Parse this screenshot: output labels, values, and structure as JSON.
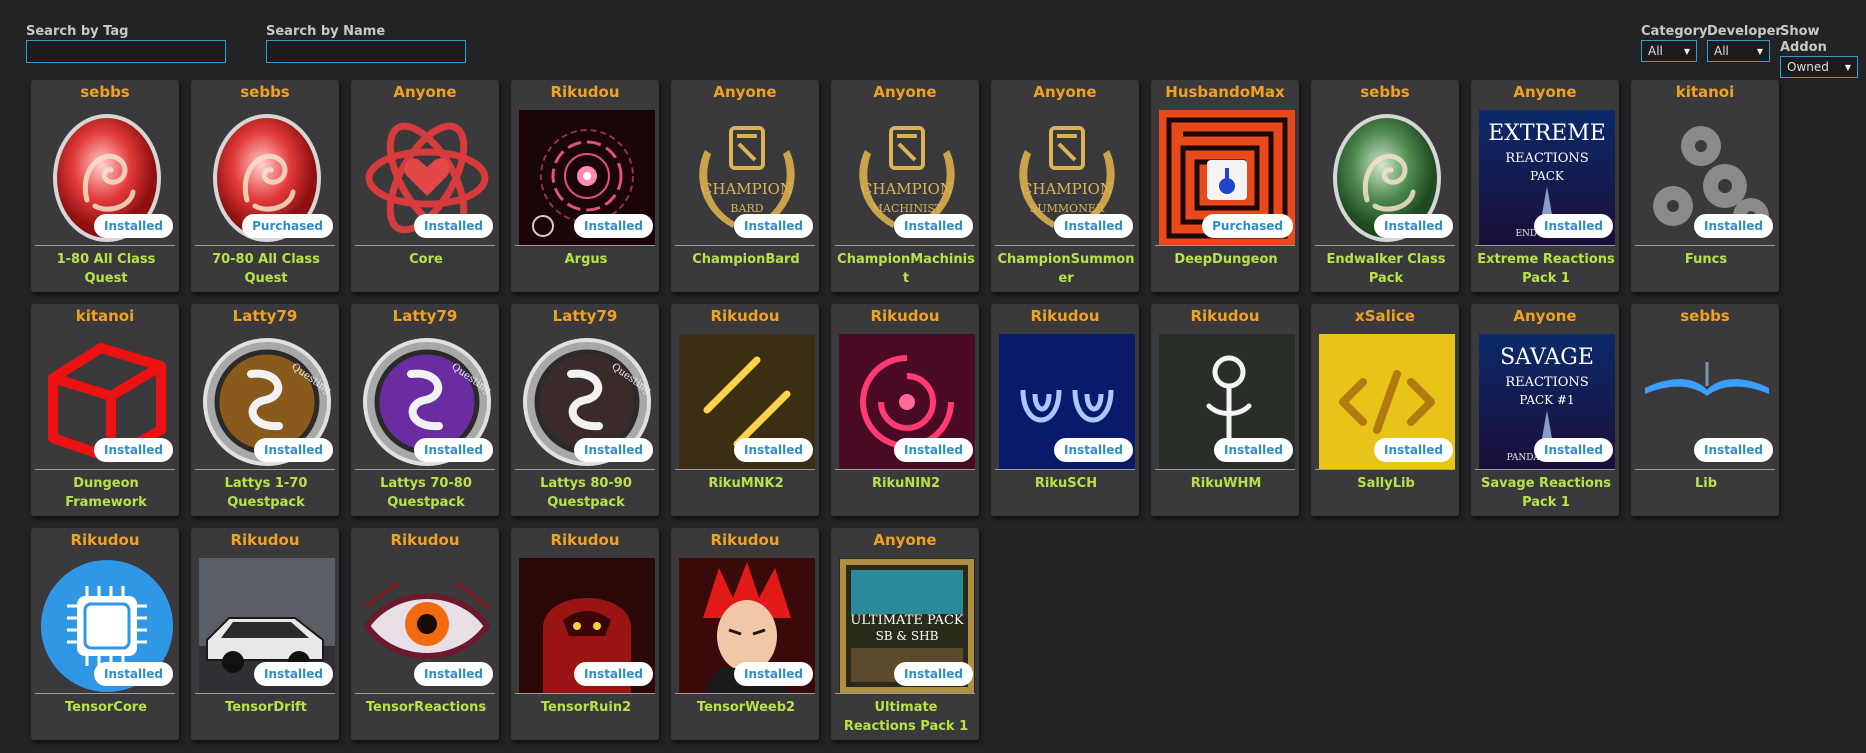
{
  "filters": {
    "tag_label": "Search by Tag",
    "tag_value": "",
    "name_label": "Search by Name",
    "name_value": "",
    "category_label": "Category",
    "category_value": "All",
    "developer_label": "Developer",
    "developer_value": "All",
    "addon_label": "Show Addon",
    "addon_value": "Owned"
  },
  "colors": {
    "background": "#232325",
    "card": "#3a3a3c",
    "developer_text": "#f0a21c",
    "name_text": "#b5e34a",
    "badge_text": "#2a8fce",
    "input_border": "#2e9dd8"
  },
  "addons": [
    {
      "developer": "sebbs",
      "name": "1-80 All Class Quest",
      "status": "Installed",
      "icon": "red-dragon-orb-icon"
    },
    {
      "developer": "sebbs",
      "name": "70-80 All Class Quest",
      "status": "Purchased",
      "icon": "red-dragon-orb-icon"
    },
    {
      "developer": "Anyone",
      "name": "Core",
      "status": "Installed",
      "icon": "heart-atom-icon"
    },
    {
      "developer": "Rikudou",
      "name": "Argus",
      "status": "Installed",
      "icon": "radar-eye-icon"
    },
    {
      "developer": "Anyone",
      "name": "ChampionBard",
      "status": "Installed",
      "icon": "champion-laurel-icon",
      "emblem_text": "CHAMPION",
      "emblem_sub": "BARD"
    },
    {
      "developer": "Anyone",
      "name": "ChampionMachinist",
      "status": "Installed",
      "icon": "champion-laurel-icon",
      "emblem_text": "CHAMPION",
      "emblem_sub": "MACHINIST"
    },
    {
      "developer": "Anyone",
      "name": "ChampionSummoner",
      "status": "Installed",
      "icon": "champion-laurel-icon",
      "emblem_text": "CHAMPION",
      "emblem_sub": "SUMMONER"
    },
    {
      "developer": "HusbandoMax",
      "name": "DeepDungeon",
      "status": "Purchased",
      "icon": "maze-icon"
    },
    {
      "developer": "sebbs",
      "name": "Endwalker Class Pack",
      "status": "Installed",
      "icon": "green-dragon-orb-icon"
    },
    {
      "developer": "Anyone",
      "name": "Extreme Reactions Pack 1",
      "status": "Installed",
      "icon": "extreme-reactions-cover-icon",
      "cover_title": "EXTREME",
      "cover_sub": "REACTIONS",
      "cover_sub2": "PACK",
      "cover_tag": "ENDWALKER"
    },
    {
      "developer": "kitanoi",
      "name": "Funcs",
      "status": "Installed",
      "icon": "gears-icon"
    },
    {
      "developer": "kitanoi",
      "name": "Dungeon Framework",
      "status": "Installed",
      "icon": "red-cube-icon"
    },
    {
      "developer": "Latty79",
      "name": "Lattys 1-70 Questpack",
      "status": "Installed",
      "icon": "bronze-dragon-medallion-icon",
      "medallion_text": "Questing"
    },
    {
      "developer": "Latty79",
      "name": "Lattys 70-80 Questpack",
      "status": "Installed",
      "icon": "purple-dragon-medallion-icon",
      "medallion_text": "Questing"
    },
    {
      "developer": "Latty79",
      "name": "Lattys 80-90 Questpack",
      "status": "Installed",
      "icon": "dark-dragon-medallion-icon",
      "medallion_text": "Questing"
    },
    {
      "developer": "Rikudou",
      "name": "RikuMNK2",
      "status": "Installed",
      "icon": "neon-monk-icon"
    },
    {
      "developer": "Rikudou",
      "name": "RikuNIN2",
      "status": "Installed",
      "icon": "neon-ninja-icon"
    },
    {
      "developer": "Rikudou",
      "name": "RikuSCH",
      "status": "Installed",
      "icon": "neon-scholar-icon"
    },
    {
      "developer": "Rikudou",
      "name": "RikuWHM",
      "status": "Installed",
      "icon": "neon-whitemage-icon"
    },
    {
      "developer": "xSalice",
      "name": "SallyLib",
      "status": "Installed",
      "icon": "code-brackets-icon"
    },
    {
      "developer": "Anyone",
      "name": "Savage Reactions Pack 1",
      "status": "Installed",
      "icon": "savage-reactions-cover-icon",
      "cover_title": "SAVAGE",
      "cover_sub": "REACTIONS",
      "cover_sub2": "PACK #1",
      "cover_tag": "PANDÆMONIUM"
    },
    {
      "developer": "sebbs",
      "name": "Lib",
      "status": "Installed",
      "icon": "open-book-icon"
    },
    {
      "developer": "Rikudou",
      "name": "TensorCore",
      "status": "Installed",
      "icon": "cpu-chip-icon"
    },
    {
      "developer": "Rikudou",
      "name": "TensorDrift",
      "status": "Installed",
      "icon": "drift-car-icon"
    },
    {
      "developer": "Rikudou",
      "name": "TensorReactions",
      "status": "Installed",
      "icon": "all-seeing-eye-icon"
    },
    {
      "developer": "Rikudou",
      "name": "TensorRuin2",
      "status": "Installed",
      "icon": "crimson-knight-icon"
    },
    {
      "developer": "Rikudou",
      "name": "TensorWeeb2",
      "status": "Installed",
      "icon": "anime-warrior-icon"
    },
    {
      "developer": "Anyone",
      "name": "Ultimate Reactions Pack 1",
      "status": "Installed",
      "icon": "ultimate-reactions-cover-icon",
      "cover_title": "ULTIMATE PACK",
      "cover_sub": "SB & SHB"
    }
  ]
}
